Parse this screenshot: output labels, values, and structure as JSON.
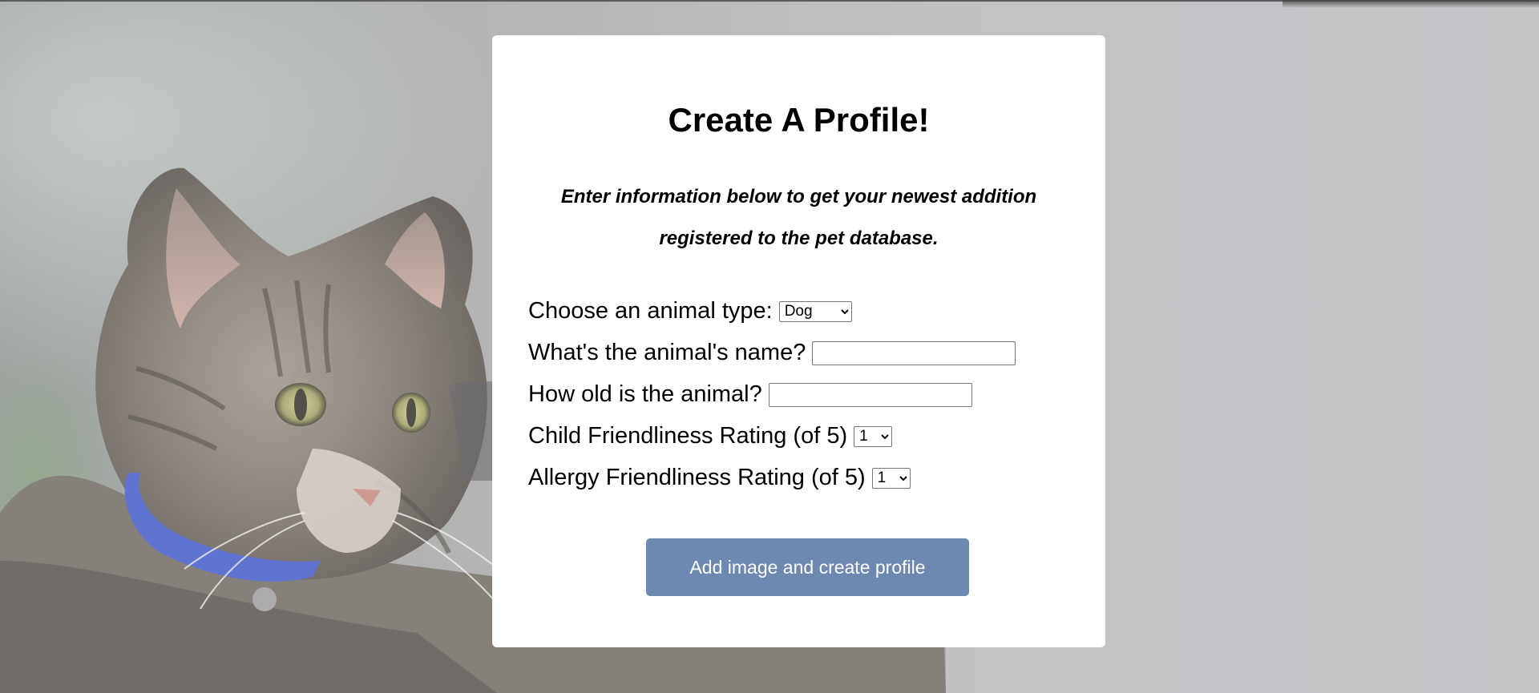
{
  "form": {
    "title": "Create A Profile!",
    "subtitle_line1": "Enter information below to get your newest addition",
    "subtitle_line2": "registered to the pet database.",
    "animal_type_label": "Choose an animal type:",
    "animal_type_value": "Dog",
    "name_label": "What's the animal's name?",
    "name_value": "",
    "age_label": "How old is the animal?",
    "age_value": "",
    "child_label": "Child Friendliness Rating (of 5)",
    "child_value": "1",
    "allergy_label": "Allergy Friendliness Rating (of 5)",
    "allergy_value": "1",
    "submit_label": "Add image and create profile"
  },
  "colors": {
    "button": "#6e87b3",
    "card": "#ffffff",
    "collar": "#3f55c6"
  },
  "background": {
    "image": "tabby cat with blue collar"
  }
}
